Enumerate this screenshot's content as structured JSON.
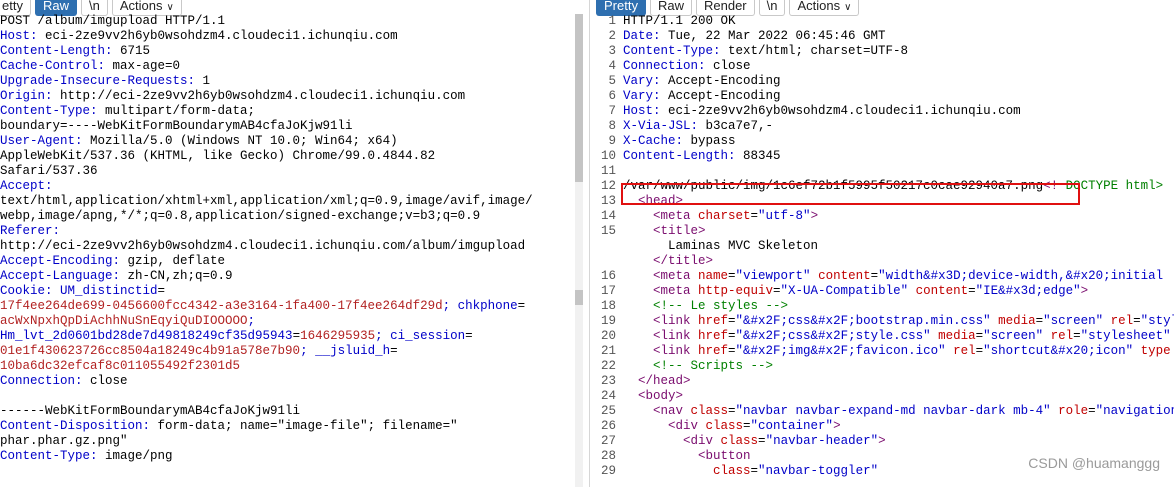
{
  "left_toolbar": {
    "pretty": "etty",
    "raw": "Raw",
    "newline": "\\n",
    "actions": "Actions",
    "actions_icon": "chevron-down-icon"
  },
  "right_toolbar": {
    "pretty": "Pretty",
    "raw": "Raw",
    "render": "Render",
    "newline": "\\n",
    "actions": "Actions",
    "actions_icon": "chevron-down-icon"
  },
  "request_lines": [
    {
      "t": "plain",
      "text": "POST /album/imgupload HTTP/1.1"
    },
    {
      "t": "hdr",
      "name": "Host: ",
      "value": "eci-2ze9vv2h6yb0wsohdzm4.cloudeci1.ichunqiu.com"
    },
    {
      "t": "hdr",
      "name": "Content-Length: ",
      "value": "6715"
    },
    {
      "t": "hdr",
      "name": "Cache-Control: ",
      "value": "max-age=0"
    },
    {
      "t": "hdr",
      "name": "Upgrade-Insecure-Requests: ",
      "value": "1"
    },
    {
      "t": "hdr",
      "name": "Origin: ",
      "value": "http://eci-2ze9vv2h6yb0wsohdzm4.cloudeci1.ichunqiu.com"
    },
    {
      "t": "hdr",
      "name": "Content-Type: ",
      "value": "multipart/form-data;"
    },
    {
      "t": "plain",
      "text": "boundary=----WebKitFormBoundarymAB4cfaJoKjw91li"
    },
    {
      "t": "hdr",
      "name": "User-Agent: ",
      "value": "Mozilla/5.0 (Windows NT 10.0; Win64; x64)"
    },
    {
      "t": "plain",
      "text": "AppleWebKit/537.36 (KHTML, like Gecko) Chrome/99.0.4844.82"
    },
    {
      "t": "plain",
      "text": "Safari/537.36"
    },
    {
      "t": "hdr",
      "name": "Accept: ",
      "value": ""
    },
    {
      "t": "plain",
      "text": "text/html,application/xhtml+xml,application/xml;q=0.9,image/avif,image/"
    },
    {
      "t": "plain",
      "text": "webp,image/apng,*/*;q=0.8,application/signed-exchange;v=b3;q=0.9"
    },
    {
      "t": "hdr",
      "name": "Referer: ",
      "value": ""
    },
    {
      "t": "plain",
      "text": "http://eci-2ze9vv2h6yb0wsohdzm4.cloudeci1.ichunqiu.com/album/imgupload"
    },
    {
      "t": "hdr",
      "name": "Accept-Encoding: ",
      "value": "gzip, deflate"
    },
    {
      "t": "hdr",
      "name": "Accept-Language: ",
      "value": "zh-CN,zh;q=0.9"
    },
    {
      "t": "cookie",
      "parts": [
        {
          "k": "Cookie: ",
          "v": ""
        },
        {
          "k": "UM_distinctid",
          "sep": "=",
          "v": ""
        }
      ]
    },
    {
      "t": "cookie",
      "parts": [
        {
          "k": "",
          "v": "17f4ee264de699-0456600fcc4342-a3e3164-1fa400-17f4ee264df29d"
        },
        {
          "k": "; chkphone",
          "sep": "=",
          "v": ""
        }
      ]
    },
    {
      "t": "cookie",
      "parts": [
        {
          "k": "",
          "v": "acWxNpxhQpDiAchhNuSnEqyiQuDIOOOOO"
        },
        {
          "k": ";",
          "sep": "",
          "v": ""
        }
      ]
    },
    {
      "t": "cookie",
      "parts": [
        {
          "k": "Hm_lvt_2d0601bd28de7d49818249cf35d95943",
          "sep": "=",
          "v": "1646295935"
        },
        {
          "k": "; ci_session",
          "sep": "=",
          "v": ""
        }
      ]
    },
    {
      "t": "cookie",
      "parts": [
        {
          "k": "",
          "v": "01e1f430623726cc8504a18249c4b91a578e7b90"
        },
        {
          "k": "; __jsluid_h",
          "sep": "=",
          "v": ""
        }
      ]
    },
    {
      "t": "cookie",
      "parts": [
        {
          "k": "",
          "v": "10ba6dc32efcaf8c011055492f2301d5"
        }
      ]
    },
    {
      "t": "hdr",
      "name": "Connection: ",
      "value": "close"
    },
    {
      "t": "plain",
      "text": ""
    },
    {
      "t": "plain",
      "text": "------WebKitFormBoundarymAB4cfaJoKjw91li"
    },
    {
      "t": "hdr",
      "name": "Content-Disposition: ",
      "value": "form-data; name=\"image-file\"; filename=\""
    },
    {
      "t": "plain",
      "text": "phar.phar.gz.png\""
    },
    {
      "t": "hdr",
      "name": "Content-Type: ",
      "value": "image/png"
    }
  ],
  "response_lines": [
    {
      "n": "1",
      "segs": [
        {
          "c": "txt",
          "s": "HTTP/1.1 200 OK"
        }
      ]
    },
    {
      "n": "2",
      "segs": [
        {
          "c": "val",
          "s": "Date: "
        },
        {
          "c": "txt",
          "s": "Tue, 22 Mar 2022 06:45:46 GMT"
        }
      ]
    },
    {
      "n": "3",
      "segs": [
        {
          "c": "val",
          "s": "Content-Type: "
        },
        {
          "c": "txt",
          "s": "text/html; charset=UTF-8"
        }
      ]
    },
    {
      "n": "4",
      "segs": [
        {
          "c": "val",
          "s": "Connection: "
        },
        {
          "c": "txt",
          "s": "close"
        }
      ]
    },
    {
      "n": "5",
      "segs": [
        {
          "c": "val",
          "s": "Vary: "
        },
        {
          "c": "txt",
          "s": "Accept-Encoding"
        }
      ]
    },
    {
      "n": "6",
      "segs": [
        {
          "c": "val",
          "s": "Vary: "
        },
        {
          "c": "txt",
          "s": "Accept-Encoding"
        }
      ]
    },
    {
      "n": "7",
      "segs": [
        {
          "c": "val",
          "s": "Host: "
        },
        {
          "c": "txt",
          "s": "eci-2ze9vv2h6yb0wsohdzm4.cloudeci1.ichunqiu.com"
        }
      ]
    },
    {
      "n": "8",
      "segs": [
        {
          "c": "val",
          "s": "X-Via-JSL: "
        },
        {
          "c": "txt",
          "s": "b3ca7e7,-"
        }
      ]
    },
    {
      "n": "9",
      "segs": [
        {
          "c": "val",
          "s": "X-Cache: "
        },
        {
          "c": "txt",
          "s": "bypass"
        }
      ]
    },
    {
      "n": "10",
      "segs": [
        {
          "c": "val",
          "s": "Content-Length: "
        },
        {
          "c": "txt",
          "s": "88345"
        }
      ]
    },
    {
      "n": "11",
      "segs": [
        {
          "c": "txt",
          "s": ""
        }
      ]
    },
    {
      "n": "12",
      "segs": [
        {
          "c": "txt",
          "s": "/var/www/public/img/1c6ef72b1f5995f50217c0cae92940a7.png"
        },
        {
          "c": "tag",
          "s": "<!"
        },
        {
          "c": "cmt",
          "s": " DOCTYPE html>"
        }
      ]
    },
    {
      "n": "13",
      "segs": [
        {
          "c": "tag",
          "s": "  <head>"
        }
      ]
    },
    {
      "n": "14",
      "segs": [
        {
          "c": "tag",
          "s": "    <meta "
        },
        {
          "c": "attr",
          "s": "charset"
        },
        {
          "c": "txt",
          "s": "="
        },
        {
          "c": "val",
          "s": "\"utf-8\""
        },
        {
          "c": "tag",
          "s": ">"
        }
      ]
    },
    {
      "n": "15",
      "segs": [
        {
          "c": "tag",
          "s": "    <title>"
        }
      ]
    },
    {
      "n": "",
      "segs": [
        {
          "c": "txt",
          "s": "      Laminas MVC Skeleton"
        }
      ]
    },
    {
      "n": "",
      "segs": [
        {
          "c": "tag",
          "s": "    </title>"
        }
      ]
    },
    {
      "n": "16",
      "segs": [
        {
          "c": "tag",
          "s": "    <meta "
        },
        {
          "c": "attr",
          "s": "name"
        },
        {
          "c": "txt",
          "s": "="
        },
        {
          "c": "val",
          "s": "\"viewport\""
        },
        {
          "c": "attr",
          "s": " content"
        },
        {
          "c": "txt",
          "s": "="
        },
        {
          "c": "val",
          "s": "\"width&#x3D;device-width,&#x20;initial"
        }
      ]
    },
    {
      "n": "17",
      "segs": [
        {
          "c": "tag",
          "s": "    <meta "
        },
        {
          "c": "attr",
          "s": "http-equiv"
        },
        {
          "c": "txt",
          "s": "="
        },
        {
          "c": "val",
          "s": "\"X-UA-Compatible\""
        },
        {
          "c": "attr",
          "s": " content"
        },
        {
          "c": "txt",
          "s": "="
        },
        {
          "c": "val",
          "s": "\"IE&#x3d;edge\""
        },
        {
          "c": "tag",
          "s": ">"
        }
      ]
    },
    {
      "n": "18",
      "segs": [
        {
          "c": "cmt",
          "s": "    <!-- Le styles -->"
        }
      ]
    },
    {
      "n": "19",
      "segs": [
        {
          "c": "tag",
          "s": "    <link "
        },
        {
          "c": "attr",
          "s": "href"
        },
        {
          "c": "txt",
          "s": "="
        },
        {
          "c": "val",
          "s": "\"&#x2F;css&#x2F;bootstrap.min.css\""
        },
        {
          "c": "attr",
          "s": " media"
        },
        {
          "c": "txt",
          "s": "="
        },
        {
          "c": "val",
          "s": "\"screen\""
        },
        {
          "c": "attr",
          "s": " rel"
        },
        {
          "c": "txt",
          "s": "="
        },
        {
          "c": "val",
          "s": "\"stylesheet"
        }
      ]
    },
    {
      "n": "20",
      "segs": [
        {
          "c": "tag",
          "s": "    <link "
        },
        {
          "c": "attr",
          "s": "href"
        },
        {
          "c": "txt",
          "s": "="
        },
        {
          "c": "val",
          "s": "\"&#x2F;css&#x2F;style.css\""
        },
        {
          "c": "attr",
          "s": " media"
        },
        {
          "c": "txt",
          "s": "="
        },
        {
          "c": "val",
          "s": "\"screen\""
        },
        {
          "c": "attr",
          "s": " rel"
        },
        {
          "c": "txt",
          "s": "="
        },
        {
          "c": "val",
          "s": "\"stylesheet\""
        }
      ]
    },
    {
      "n": "21",
      "segs": [
        {
          "c": "tag",
          "s": "    <link "
        },
        {
          "c": "attr",
          "s": "href"
        },
        {
          "c": "txt",
          "s": "="
        },
        {
          "c": "val",
          "s": "\"&#x2F;img&#x2F;favicon.ico\""
        },
        {
          "c": "attr",
          "s": " rel"
        },
        {
          "c": "txt",
          "s": "="
        },
        {
          "c": "val",
          "s": "\"shortcut&#x20;icon\""
        },
        {
          "c": "attr",
          "s": " type"
        }
      ]
    },
    {
      "n": "22",
      "segs": [
        {
          "c": "cmt",
          "s": "    <!-- Scripts -->"
        }
      ]
    },
    {
      "n": "23",
      "segs": [
        {
          "c": "tag",
          "s": "  </head>"
        }
      ]
    },
    {
      "n": "24",
      "segs": [
        {
          "c": "tag",
          "s": "  <body>"
        }
      ]
    },
    {
      "n": "25",
      "segs": [
        {
          "c": "tag",
          "s": "    <nav "
        },
        {
          "c": "attr",
          "s": "class"
        },
        {
          "c": "txt",
          "s": "="
        },
        {
          "c": "val",
          "s": "\"navbar navbar-expand-md navbar-dark mb-4\""
        },
        {
          "c": "attr",
          "s": " role"
        },
        {
          "c": "txt",
          "s": "="
        },
        {
          "c": "val",
          "s": "\"navigation"
        }
      ]
    },
    {
      "n": "26",
      "segs": [
        {
          "c": "tag",
          "s": "      <div "
        },
        {
          "c": "attr",
          "s": "class"
        },
        {
          "c": "txt",
          "s": "="
        },
        {
          "c": "val",
          "s": "\"container\""
        },
        {
          "c": "tag",
          "s": ">"
        }
      ]
    },
    {
      "n": "27",
      "segs": [
        {
          "c": "tag",
          "s": "        <div "
        },
        {
          "c": "attr",
          "s": "class"
        },
        {
          "c": "txt",
          "s": "="
        },
        {
          "c": "val",
          "s": "\"navbar-header\""
        },
        {
          "c": "tag",
          "s": ">"
        }
      ]
    },
    {
      "n": "28",
      "segs": [
        {
          "c": "tag",
          "s": "          <button"
        }
      ]
    },
    {
      "n": "29",
      "segs": [
        {
          "c": "attr",
          "s": "            class"
        },
        {
          "c": "txt",
          "s": "="
        },
        {
          "c": "val",
          "s": "\"navbar-toggler\""
        }
      ]
    }
  ],
  "watermark": "CSDN @huamanggg",
  "colors": {
    "active_tab": "#2e6fb0",
    "highlight_border": "#e01010"
  }
}
